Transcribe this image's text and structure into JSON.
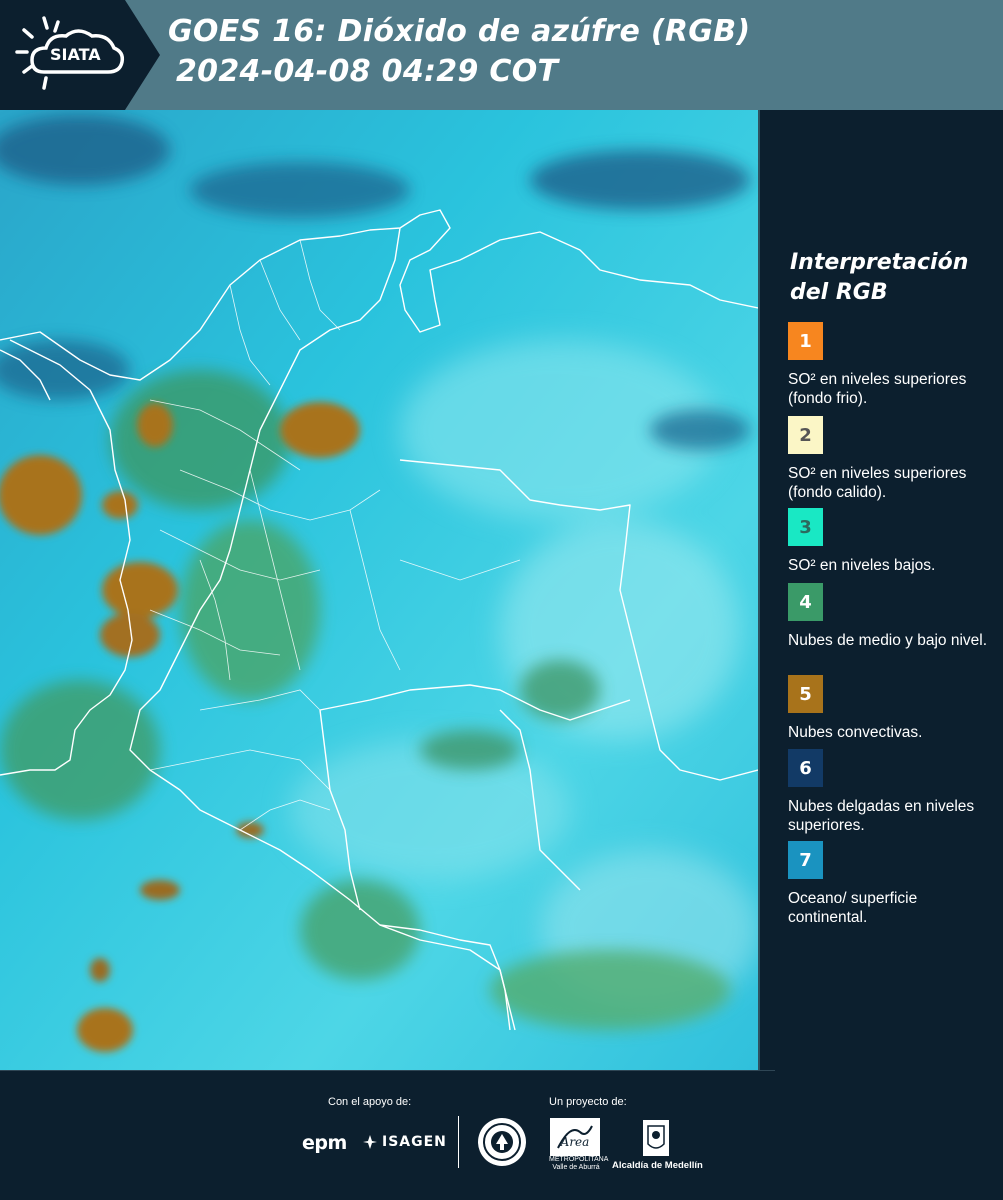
{
  "header": {
    "logo_text": "SIATA",
    "title_line1": "GOES 16: Dióxido de azúfre (RGB)",
    "title_line2": "2024-04-08 04:29 COT"
  },
  "legend": {
    "title": "Interpretación del RGB",
    "items": [
      {
        "number": "1",
        "color": "#f7861f",
        "text_color": "#ffffff",
        "label": "SO² en niveles superiores (fondo frio)."
      },
      {
        "number": "2",
        "color": "#fbf6c6",
        "text_color": "#555555",
        "label": "SO² en niveles superiores (fondo calido)."
      },
      {
        "number": "3",
        "color": "#19e8c4",
        "text_color": "#2c6a5e",
        "label": "SO² en niveles bajos."
      },
      {
        "number": "4",
        "color": "#3a9a68",
        "text_color": "#ffffff",
        "label": "Nubes de medio y bajo nivel."
      },
      {
        "number": "5",
        "color": "#a8731b",
        "text_color": "#ffffff",
        "label": "Nubes convectivas."
      },
      {
        "number": "6",
        "color": "#123a66",
        "text_color": "#ffffff",
        "label": "Nubes delgadas en niveles superiores."
      },
      {
        "number": "7",
        "color": "#1a93c0",
        "text_color": "#ffffff",
        "label": "Oceano/ superficie continental."
      }
    ]
  },
  "footer": {
    "support_label": "Con el apoyo de:",
    "project_label": "Un proyecto de:",
    "epm_logo": "epm",
    "isagen_logo": "ISAGEN",
    "area_logo_text": "Área",
    "area_caption": "METROPOLITANA Valle de Aburrá",
    "alcaldia_label": "Alcaldía de Medellín"
  },
  "map_colors": {
    "ocean_continental": "#22c3de",
    "mid_low_clouds": "#3a9a68",
    "convective_clouds": "#a8731b",
    "thin_high_clouds": "#123a66",
    "boundaries": "#ffffff"
  }
}
